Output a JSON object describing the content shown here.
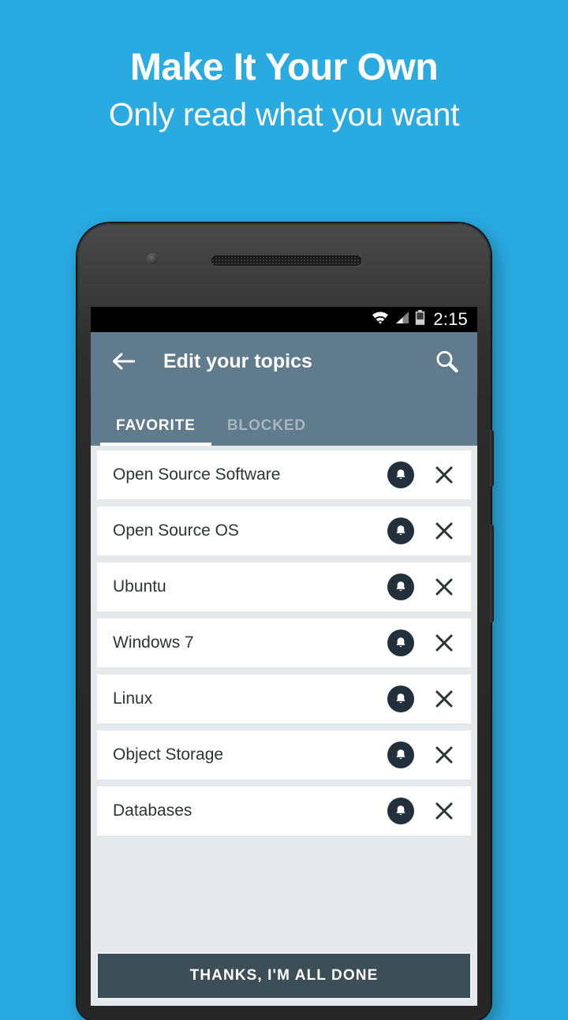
{
  "promo": {
    "title": "Make It Your Own",
    "subtitle": "Only read what you want",
    "background_color": "#29abe2"
  },
  "phone": {
    "status_bar": {
      "time": "2:15",
      "icons": [
        "wifi-icon",
        "signal-icon",
        "battery-icon"
      ]
    },
    "app_bar": {
      "back_icon": "back-arrow-icon",
      "title": "Edit your topics",
      "search_icon": "search-icon",
      "color": "#5f7b8c"
    },
    "tabs": [
      {
        "label": "FAVORITE",
        "active": true
      },
      {
        "label": "BLOCKED",
        "active": false
      }
    ],
    "topics": [
      {
        "name": "Open Source Software",
        "bell_icon": "bell-icon",
        "remove_icon": "close-icon"
      },
      {
        "name": "Open Source OS",
        "bell_icon": "bell-icon",
        "remove_icon": "close-icon"
      },
      {
        "name": "Ubuntu",
        "bell_icon": "bell-icon",
        "remove_icon": "close-icon"
      },
      {
        "name": "Windows 7",
        "bell_icon": "bell-icon",
        "remove_icon": "close-icon"
      },
      {
        "name": "Linux",
        "bell_icon": "bell-icon",
        "remove_icon": "close-icon"
      },
      {
        "name": "Object Storage",
        "bell_icon": "bell-icon",
        "remove_icon": "close-icon"
      },
      {
        "name": "Databases",
        "bell_icon": "bell-icon",
        "remove_icon": "close-icon"
      }
    ],
    "done_button": {
      "label": "THANKS, I'M ALL DONE",
      "color": "#3c4f58"
    },
    "colors": {
      "list_background": "#e5e9eb",
      "row_background": "#ffffff",
      "row_text": "#2e3338",
      "bell_circle": "#22303c"
    }
  }
}
